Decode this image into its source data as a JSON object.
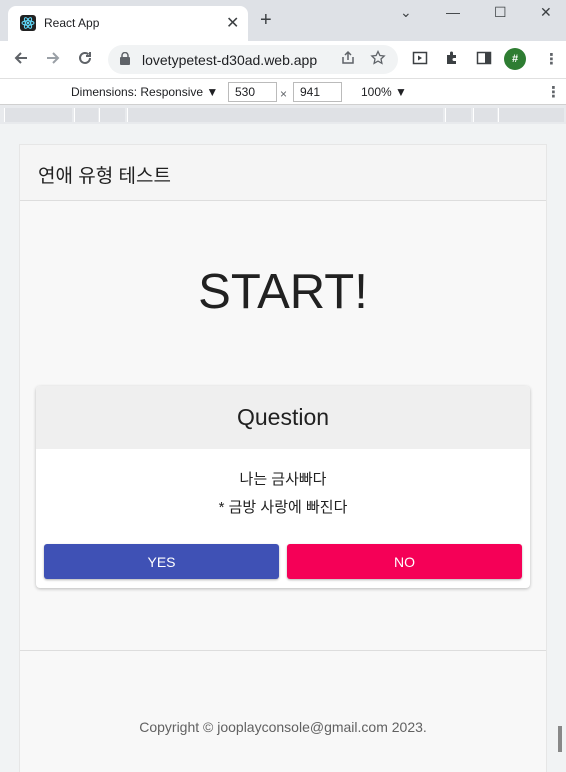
{
  "browser": {
    "tab_title": "React App",
    "tab_close": "✕",
    "new_tab": "+",
    "url": "lovetypetest-d30ad.web.app",
    "profile_initial": "#",
    "window_minimize": "—",
    "window_maximize": "☐",
    "window_close": "✕",
    "tabs_dropdown": "⌄"
  },
  "devtools": {
    "dimensions_label": "Dimensions: Responsive ▼",
    "width_value": "530",
    "times": "×",
    "height_value": "941",
    "zoom": "100% ▼",
    "more": "⋮"
  },
  "app": {
    "header_title": "연애 유형 테스트",
    "start_heading": "START!",
    "card": {
      "title": "Question",
      "line1": "나는 금사빠다",
      "line2": "* 금방 사랑에 빠진다",
      "yes_label": "YES",
      "no_label": "NO"
    },
    "footer": "Copyright © jooplayconsole@gmail.com 2023."
  },
  "colors": {
    "yes_button": "#3f51b5",
    "no_button": "#f50057"
  }
}
